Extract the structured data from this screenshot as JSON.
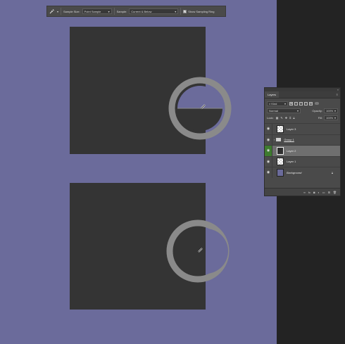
{
  "options_bar": {
    "tool_icon": "eyedropper-icon",
    "sample_size_label": "Sample Size:",
    "sample_size_value": "Point Sample",
    "sample_label": "Sample:",
    "sample_value": "Current & Below",
    "show_ring_label": "Show Sampling Ring",
    "show_ring_checked": true
  },
  "colors": {
    "canvas": "#6b6b9b",
    "square": "#343434",
    "ring": "#8a8a8a",
    "dark_bg": "#232323"
  },
  "layers_panel": {
    "tab_label": "Layers",
    "filter_value": "Kind",
    "blend_mode": "Normal",
    "opacity_label": "Opacity:",
    "opacity_value": "100%",
    "lock_label": "Lock:",
    "fill_label": "Fill:",
    "fill_value": "100%",
    "layers": [
      {
        "name": "Layer 3",
        "thumb": "check",
        "visible": true
      },
      {
        "name": "Group 1",
        "thumb": "folder",
        "visible": true
      },
      {
        "name": "Layer 2",
        "thumb": "dark",
        "visible": true,
        "selected": true
      },
      {
        "name": "Layer 1",
        "thumb": "check",
        "visible": true
      },
      {
        "name": "Background",
        "thumb": "bg",
        "visible": true,
        "locked": true
      }
    ],
    "bottom_icons": [
      "link-icon",
      "fx-icon",
      "mask-icon",
      "adjustment-icon",
      "folder-icon",
      "new-layer-icon",
      "trash-icon"
    ]
  }
}
